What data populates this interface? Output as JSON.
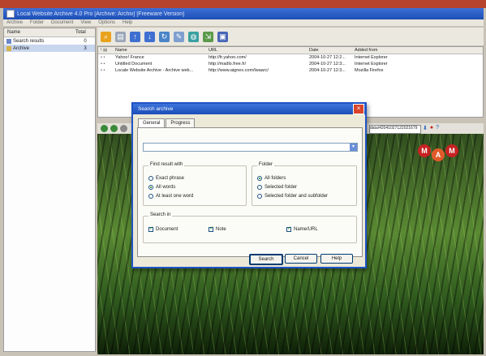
{
  "window": {
    "title": "Local Website Archive 4.0 Pro      [Archive: Archiv]      [Freeware Version]"
  },
  "menu": [
    "Archive",
    "Folder",
    "Document",
    "View",
    "Options",
    "Help"
  ],
  "tree": {
    "headers": {
      "name": "Name",
      "total": "Total"
    },
    "rows": [
      {
        "name": "Search results",
        "count": "0"
      },
      {
        "name": "Archive",
        "count": "3"
      }
    ]
  },
  "list": {
    "headers": {
      "name": "Name",
      "url": "URL",
      "date": "Date",
      "added": "Added from"
    },
    "rows": [
      {
        "name": "Yahoo! France",
        "url": "http://fr.yahoo.com/",
        "date": "2004-10-27 12:2...",
        "added": "Internet Explorer"
      },
      {
        "name": "Untitled Document",
        "url": "http://madlo.free.fr/",
        "date": "2004-10-27 12:3...",
        "added": "Internet Explorer"
      },
      {
        "name": "Locale Website Archive - Archive web...",
        "url": "http://www.aignes.com/lwaarc/",
        "date": "2004-10-27 12:3...",
        "added": "Mozilla Firefox"
      }
    ]
  },
  "browser": {
    "address": "data/42041027122021679"
  },
  "dialog": {
    "title": "Search archive",
    "tabs": [
      "General",
      "Progress"
    ],
    "search_value": "",
    "find_label": "Find result with",
    "find_options": [
      "Exact phrase",
      "All words",
      "At least one word"
    ],
    "find_selected": 1,
    "folder_label": "Folder",
    "folder_options": [
      "All folders",
      "Selected folder",
      "Selected folder and subfolder"
    ],
    "folder_selected": 0,
    "searchin_label": "Search in",
    "searchin_options": [
      "Document",
      "Note",
      "Name/URL"
    ],
    "buttons": {
      "search": "Search",
      "cancel": "Cancel",
      "help": "Help"
    }
  },
  "logo": {
    "letters": [
      "M",
      "A",
      "M"
    ],
    "accent": "#c72222"
  },
  "colors": {
    "titlebar": "#1d4fb5",
    "topband": "#b5432d"
  }
}
